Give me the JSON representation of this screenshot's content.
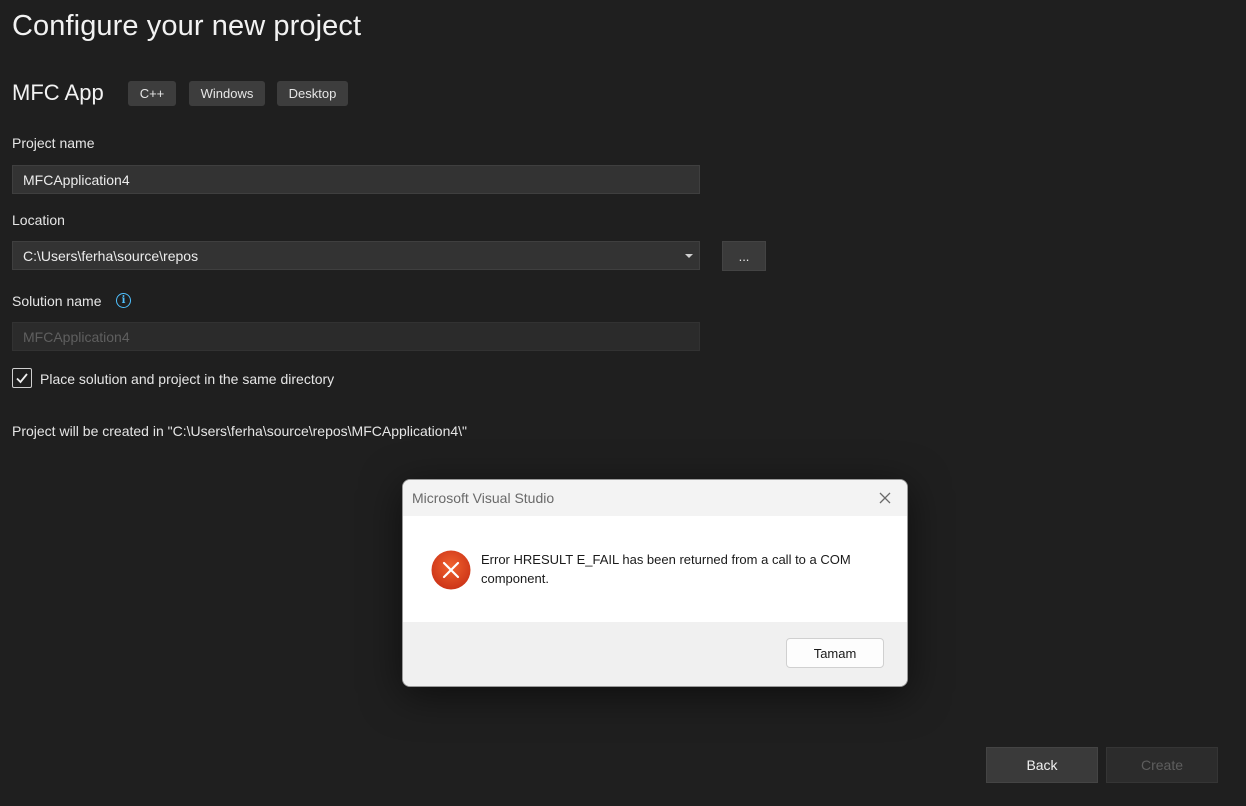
{
  "page": {
    "title": "Configure your new project"
  },
  "template": {
    "name": "MFC App",
    "tags": [
      "C++",
      "Windows",
      "Desktop"
    ]
  },
  "form": {
    "project_name_label": "Project name",
    "project_name_value": "MFCApplication4",
    "location_label": "Location",
    "location_value": "C:\\Users\\ferha\\source\\repos",
    "browse_label": "...",
    "solution_name_label": "Solution name",
    "solution_name_value": "MFCApplication4",
    "same_directory_label": "Place solution and project in the same directory",
    "same_directory_checked": true,
    "path_note": "Project will be created in \"C:\\Users\\ferha\\source\\repos\\MFCApplication4\\\""
  },
  "footer": {
    "back_label": "Back",
    "create_label": "Create"
  },
  "dialog": {
    "title": "Microsoft Visual Studio",
    "message": "Error HRESULT E_FAIL has been returned from a call to a COM component.",
    "ok_label": "Tamam"
  },
  "icons": {
    "info": "info-icon",
    "error": "error-icon",
    "close": "close-icon",
    "check": "checkmark-icon",
    "dropdown": "chevron-down-icon"
  },
  "colors": {
    "background": "#1f1f1f",
    "info_accent": "#4fc1ff",
    "error_red": "#d6361a"
  }
}
